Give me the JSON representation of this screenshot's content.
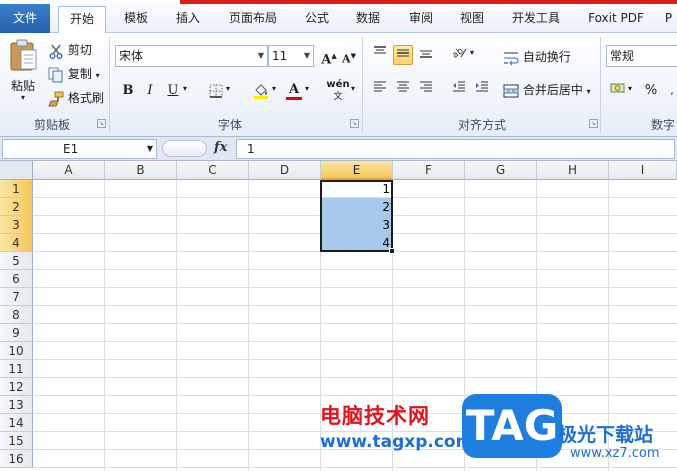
{
  "tabs": [
    {
      "id": "file",
      "label": "文件"
    },
    {
      "id": "home",
      "label": "开始"
    },
    {
      "id": "template",
      "label": "模板"
    },
    {
      "id": "insert",
      "label": "插入"
    },
    {
      "id": "layout",
      "label": "页面布局"
    },
    {
      "id": "formula",
      "label": "公式"
    },
    {
      "id": "data",
      "label": "数据"
    },
    {
      "id": "review",
      "label": "审阅"
    },
    {
      "id": "view",
      "label": "视图"
    },
    {
      "id": "dev",
      "label": "开发工具"
    },
    {
      "id": "foxit",
      "label": "Foxit PDF"
    },
    {
      "id": "more",
      "label": "P"
    }
  ],
  "clipboard": {
    "paste_label": "粘贴",
    "cut_label": "剪切",
    "copy_label": "复制",
    "format_painter_label": "格式刷",
    "group_label": "剪贴板"
  },
  "font": {
    "font_name": "宋体",
    "font_size": "11",
    "bold": "B",
    "italic": "I",
    "underline": "U",
    "font_color_letter": "A",
    "phonetic": "wén",
    "group_label": "字体",
    "grow": "A",
    "shrink": "A"
  },
  "alignment": {
    "wrap_label": "自动换行",
    "merge_label": "合并后居中",
    "group_label": "对齐方式"
  },
  "number": {
    "format": "常规",
    "percent": "%",
    "group_label": "数字"
  },
  "formula_bar": {
    "name_box": "E1",
    "fx": "fx",
    "content": "1"
  },
  "columns": [
    "A",
    "B",
    "C",
    "D",
    "E",
    "F",
    "G",
    "H",
    "I"
  ],
  "selected_column": "E",
  "rows": [
    "1",
    "2",
    "3",
    "4",
    "5",
    "6",
    "7",
    "8",
    "9",
    "10",
    "11",
    "12",
    "13",
    "14",
    "15",
    "16"
  ],
  "cells_E": [
    "1",
    "2",
    "3",
    "4"
  ],
  "watermark": {
    "title": "电脑技术网",
    "url": "www.tagxp.com",
    "logo": "TAG",
    "site": "极光下载站",
    "site_url": "www.xz7.com"
  }
}
